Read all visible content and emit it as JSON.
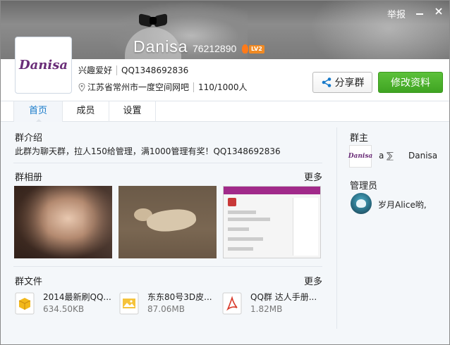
{
  "header": {
    "report_label": "举报",
    "group_name": "Danisa",
    "group_number": "76212890",
    "level": "LV2",
    "avatar_text": "Danisa"
  },
  "meta": {
    "category": "兴趣爱好",
    "qq": "QQ1348692836",
    "location": "江苏省常州市一度空间网吧",
    "member_count": "110/1000人"
  },
  "actions": {
    "share_label": "分享群",
    "edit_label": "修改资料"
  },
  "tabs": [
    {
      "label": "首页",
      "active": true
    },
    {
      "label": "成员",
      "active": false
    },
    {
      "label": "设置",
      "active": false
    }
  ],
  "intro": {
    "title": "群介绍",
    "text": "此群为聊天群，拉人150给管理，满1000管理有奖！QQ1348692836"
  },
  "album": {
    "title": "群相册",
    "more": "更多"
  },
  "files": {
    "title": "群文件",
    "more": "更多",
    "items": [
      {
        "name": "2014最新刷QQ...",
        "size": "634.50KB",
        "icon": "package-icon"
      },
      {
        "name": "东东80号3D皮...",
        "size": "87.06MB",
        "icon": "image-file-icon"
      },
      {
        "name": "QQ群 达人手册...",
        "size": "1.82MB",
        "icon": "pdf-icon"
      }
    ]
  },
  "owner": {
    "title": "群主",
    "avatar_text": "Danisa",
    "tag": "a ⅀",
    "name": "Danisa"
  },
  "admins": {
    "title": "管理员",
    "items": [
      {
        "name": "岁月Alice哟,"
      }
    ]
  },
  "colors": {
    "accent_blue": "#1679c9",
    "edit_green": "#3fa422",
    "avatar_purple": "#6a2d78",
    "level_orange": "#f08a24"
  }
}
